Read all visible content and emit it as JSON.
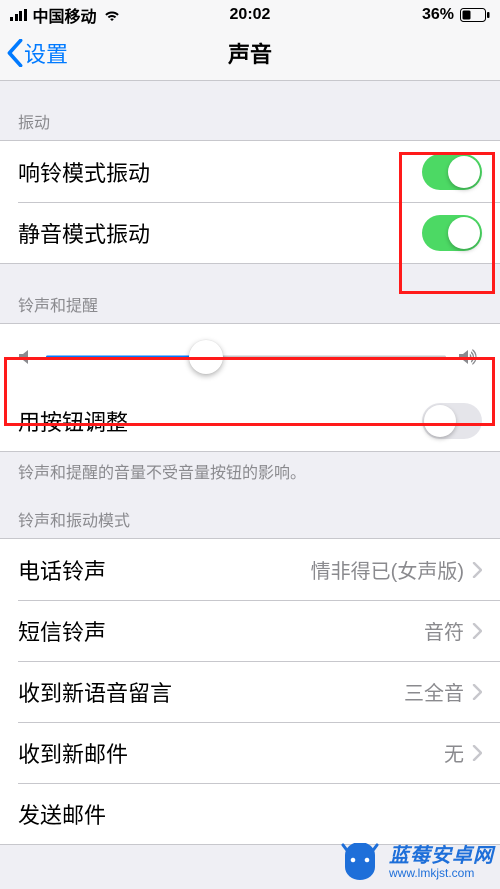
{
  "status": {
    "carrier": "中国移动",
    "time": "20:02",
    "battery_pct": "36%"
  },
  "nav": {
    "back_label": "设置",
    "title": "声音"
  },
  "sections": {
    "vibrate_header": "振动",
    "vibrate": {
      "ring_label": "响铃模式振动",
      "ring_on": true,
      "silent_label": "静音模式振动",
      "silent_on": true
    },
    "ringer_header": "铃声和提醒",
    "ringer": {
      "volume_fraction": 0.4,
      "change_with_buttons_label": "用按钮调整",
      "change_with_buttons_on": false,
      "footer": "铃声和提醒的音量不受音量按钮的影响。"
    },
    "patterns_header": "铃声和振动模式",
    "patterns": {
      "ringtone_label": "电话铃声",
      "ringtone_value": "情非得已(女声版)",
      "text_tone_label": "短信铃声",
      "text_tone_value": "音符",
      "voicemail_label": "收到新语音留言",
      "voicemail_value": "三全音",
      "mail_label": "收到新邮件",
      "mail_value": "无",
      "sent_mail_label": "发送邮件"
    }
  },
  "watermark": {
    "title": "蓝莓安卓网",
    "url": "www.lmkjst.com"
  }
}
